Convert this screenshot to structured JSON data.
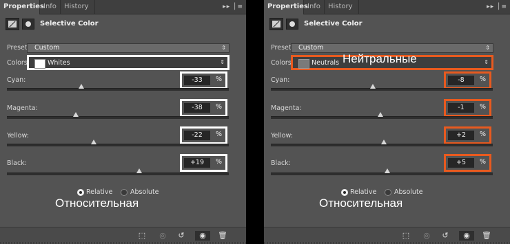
{
  "panels": [
    {
      "tabs": [
        "Properties",
        "Info",
        "History"
      ],
      "title": "Selective Color",
      "preset_label": "Preset:",
      "preset_value": "Custom",
      "colors_label": "Colors:",
      "colors_value": "Whites",
      "colors_swatch": "#ffffff",
      "overlay_colors": "",
      "sliders": [
        {
          "label": "Cyan:",
          "value": "-33",
          "unit": "%",
          "level": 33.5
        },
        {
          "label": "Magenta:",
          "value": "-38",
          "unit": "%",
          "level": 31
        },
        {
          "label": "Yellow:",
          "value": "-22",
          "unit": "%",
          "level": 39
        },
        {
          "label": "Black:",
          "value": "+19",
          "unit": "%",
          "level": 59.5
        }
      ],
      "relative_label": "Relative",
      "absolute_label": "Absolute",
      "method": "relative",
      "overlay_relative": "Относительная",
      "highlight_color": "#ffffff"
    },
    {
      "tabs": [
        "Properties",
        "Info",
        "History"
      ],
      "title": "Selective Color",
      "preset_label": "Preset:",
      "preset_value": "Custom",
      "colors_label": "Colors:",
      "colors_value": "Neutrals",
      "colors_swatch": "#7a7a7a",
      "overlay_colors": "Нейтральные",
      "sliders": [
        {
          "label": "Cyan:",
          "value": "-8",
          "unit": "%",
          "level": 46
        },
        {
          "label": "Magenta:",
          "value": "-1",
          "unit": "%",
          "level": 49.5
        },
        {
          "label": "Yellow:",
          "value": "+2",
          "unit": "%",
          "level": 51
        },
        {
          "label": "Black:",
          "value": "+5",
          "unit": "%",
          "level": 52.5
        }
      ],
      "relative_label": "Relative",
      "absolute_label": "Absolute",
      "method": "relative",
      "overlay_relative": "Относительная",
      "highlight_color": "#e85a1f"
    }
  ],
  "icons": {
    "panel_menu": "panel-menu-icon",
    "collapse": "collapse-icon",
    "clip": "clip-to-layer-icon",
    "view_previous": "view-previous-icon",
    "reset": "reset-icon",
    "visibility": "eye-icon",
    "delete": "trash-icon"
  }
}
